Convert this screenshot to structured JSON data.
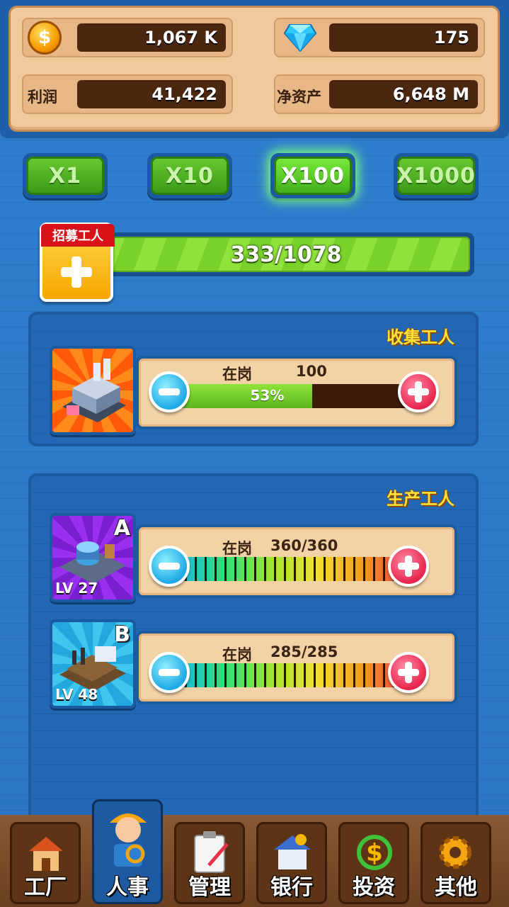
{
  "header": {
    "coins": "1,067 K",
    "gems": "175",
    "profit_label": "利润",
    "profit": "41,422",
    "net_assets_label": "净资产",
    "net_assets": "6,648 M",
    "coin_symbol": "$"
  },
  "multipliers": [
    {
      "label": "X1",
      "active": false
    },
    {
      "label": "X10",
      "active": false
    },
    {
      "label": "X100",
      "active": true
    },
    {
      "label": "X1000",
      "active": false
    }
  ],
  "recruit": {
    "tag": "招募工人",
    "progress_text": "333/1078",
    "current": 333,
    "max": 1078
  },
  "collect": {
    "title": "收集工人",
    "on_duty_label": "在岗",
    "count": "100",
    "percent_text": "53%",
    "percent": 0.53
  },
  "production": {
    "title": "生产工人",
    "factories": [
      {
        "grade": "A",
        "level": "LV 27",
        "on_duty_label": "在岗",
        "count_text": "360/360",
        "fill": 1.0
      },
      {
        "grade": "B",
        "level": "LV 48",
        "on_duty_label": "在岗",
        "count_text": "285/285",
        "fill": 1.0
      }
    ]
  },
  "nav": {
    "items": [
      {
        "label": "工厂",
        "icon": "factory-house-icon"
      },
      {
        "label": "人事",
        "icon": "worker-icon",
        "active": true
      },
      {
        "label": "管理",
        "icon": "clipboard-icon"
      },
      {
        "label": "银行",
        "icon": "bank-icon"
      },
      {
        "label": "投资",
        "icon": "dollar-arrows-icon"
      },
      {
        "label": "其他",
        "icon": "gear-icon"
      }
    ]
  },
  "colors": {
    "background": "#2f7fd0",
    "accent_green": "#67c82f",
    "title_yellow": "#ffe23a",
    "plus_red": "#e8254d",
    "minus_blue": "#1ea9e6"
  }
}
